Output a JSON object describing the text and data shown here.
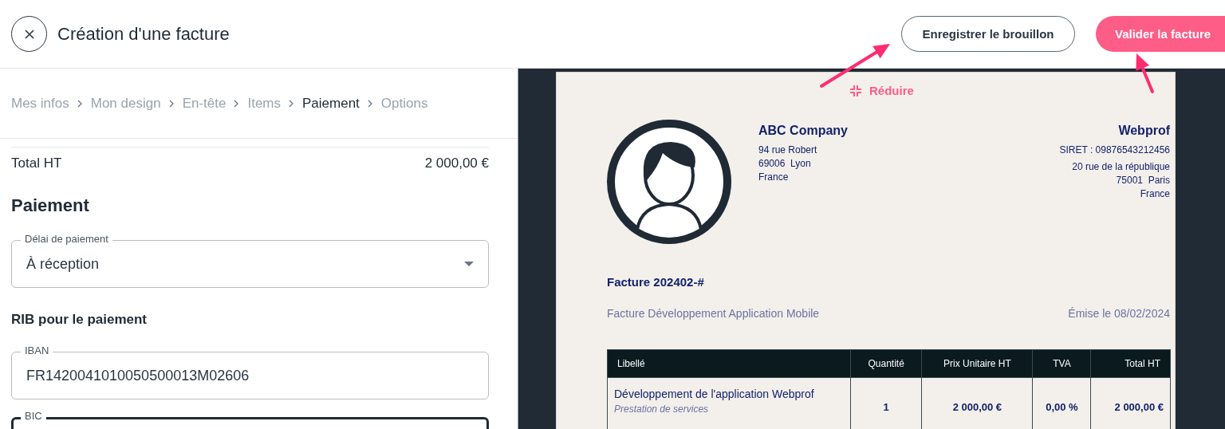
{
  "header": {
    "title": "Création d'une facture",
    "buttons": [
      {
        "label": "Enregistrer le brouillon",
        "kind": "secondary"
      },
      {
        "label": "Valider la facture",
        "kind": "primary"
      }
    ]
  },
  "breadcrumb": [
    {
      "label": "Mes infos",
      "selected": false
    },
    {
      "label": "Mon design",
      "selected": false
    },
    {
      "label": "En-tête",
      "selected": false
    },
    {
      "label": "Items",
      "selected": false
    },
    {
      "label": "Paiement",
      "selected": true
    },
    {
      "label": "Options",
      "selected": false
    }
  ],
  "form": {
    "total_label": "Total HT",
    "total_value": "2 000,00 €",
    "section_title": "Paiement",
    "payment_delay": {
      "label": "Délai de paiement",
      "value": "À réception"
    },
    "rib_title": "RIB pour le paiement",
    "iban": {
      "label": "IBAN",
      "value": "FR1420041010050500013M02606",
      "focused": false
    },
    "bic": {
      "label": "BIC",
      "focused": true
    }
  },
  "preview": {
    "collapse_label": "Réduire",
    "issuer": {
      "name": "ABC Company",
      "lines": [
        "94 rue Robert",
        "69006  Lyon",
        "France"
      ]
    },
    "client": {
      "name": "Webprof",
      "siret": "SIRET : 09876543212456",
      "lines": [
        "20 rue de la république",
        "75001  Paris",
        "France"
      ]
    },
    "invoice_number": "Facture 202402-#",
    "description": "Facture Développement Application Mobile",
    "date": "Émise le 08/02/2024",
    "table": {
      "columns": [
        "Libellé",
        "Quantité",
        "Prix Unitaire HT",
        "TVA",
        "Total HT"
      ],
      "rows": [
        {
          "label": "Développement de l'application Webprof",
          "note": "Prestation de services",
          "quantity": "1",
          "unit_price": "2 000,00 €",
          "vat": "0,00 %",
          "total": "2 000,00 €"
        }
      ]
    }
  },
  "annotations": [
    {
      "kind": "arrow"
    },
    {
      "kind": "arrow"
    }
  ]
}
